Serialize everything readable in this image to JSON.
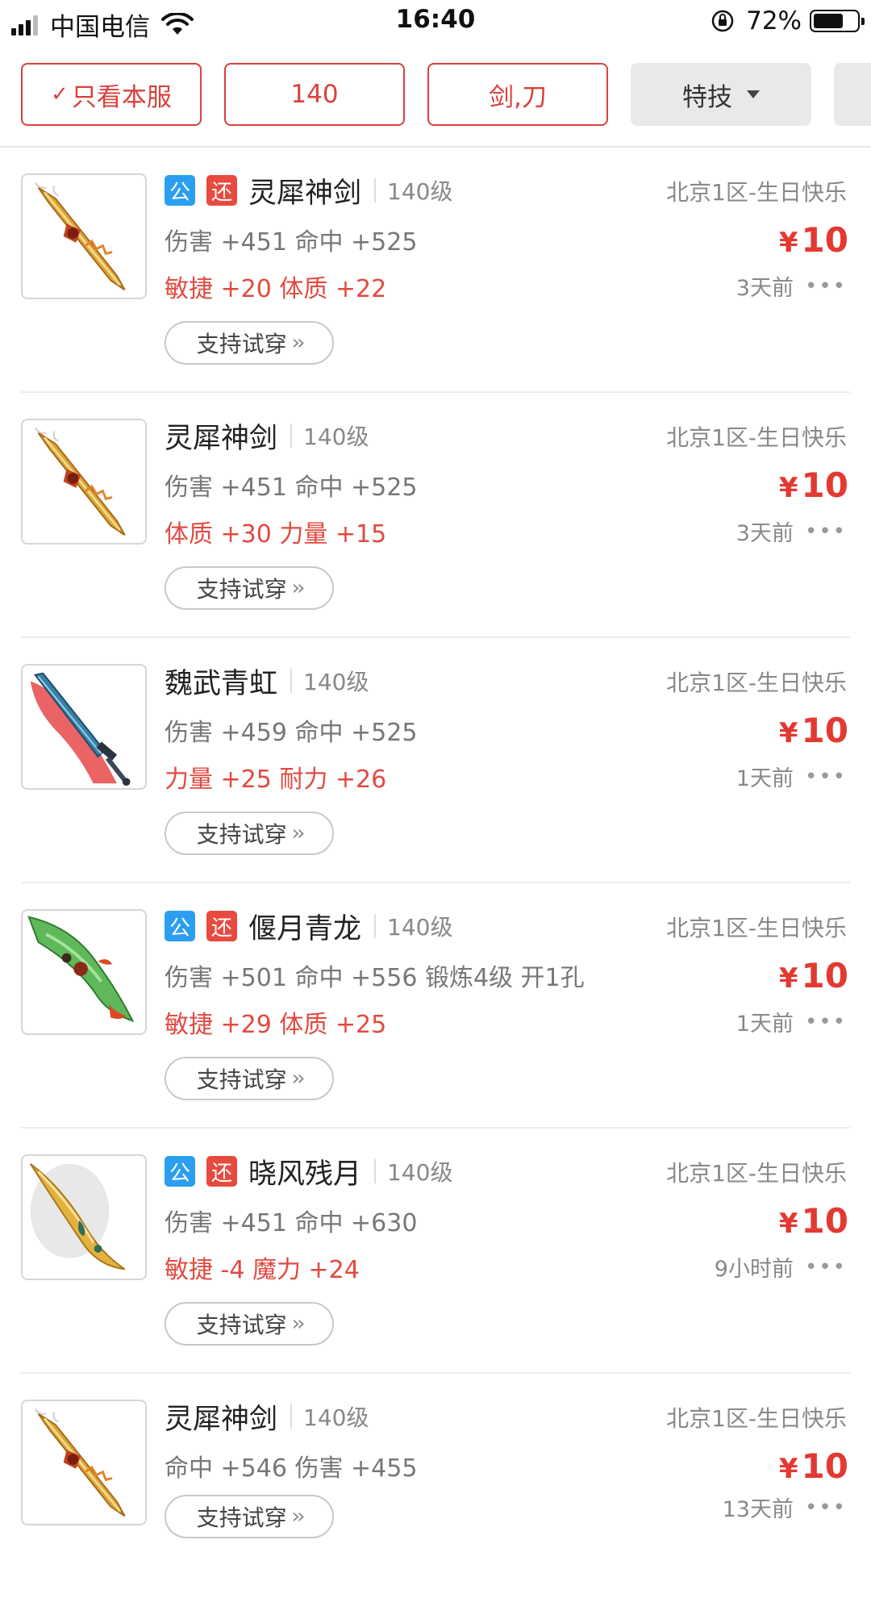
{
  "status_bar": {
    "carrier": "中国电信",
    "time": "16:40",
    "battery_percent": "72%",
    "battery_level": 0.72
  },
  "filters": [
    {
      "label": "只看本服",
      "checked": true,
      "style": "outlined"
    },
    {
      "label": "140",
      "style": "outlined"
    },
    {
      "label": "剑,刀",
      "style": "outlined"
    },
    {
      "label": "特技",
      "style": "dropdown"
    }
  ],
  "listings": [
    {
      "badges": [
        "公",
        "还"
      ],
      "name": "灵犀神剑",
      "level": "140级",
      "stats_primary": "伤害 +451 命中 +525",
      "stats_secondary": "敏捷 +20 体质 +22",
      "try_on": "支持试穿",
      "server": "北京1区-生日快乐",
      "currency": "¥",
      "price": "10",
      "time": "3天前",
      "icon": "golden-sword-icon"
    },
    {
      "badges": [],
      "name": "灵犀神剑",
      "level": "140级",
      "stats_primary": "伤害 +451 命中 +525",
      "stats_secondary": "体质 +30 力量 +15",
      "try_on": "支持试穿",
      "server": "北京1区-生日快乐",
      "currency": "¥",
      "price": "10",
      "time": "3天前",
      "icon": "golden-sword-icon"
    },
    {
      "badges": [],
      "name": "魏武青虹",
      "level": "140级",
      "stats_primary": "伤害 +459 命中 +525",
      "stats_secondary": "力量 +25 耐力 +26",
      "try_on": "支持试穿",
      "server": "北京1区-生日快乐",
      "currency": "¥",
      "price": "10",
      "time": "1天前",
      "icon": "red-blue-sword-icon"
    },
    {
      "badges": [
        "公",
        "还"
      ],
      "name": "偃月青龙",
      "level": "140级",
      "stats_primary": "伤害 +501 命中 +556 锻炼4级 开1孔",
      "stats_secondary": "敏捷 +29 体质 +25",
      "try_on": "支持试穿",
      "server": "北京1区-生日快乐",
      "currency": "¥",
      "price": "10",
      "time": "1天前",
      "icon": "green-dragon-blade-icon"
    },
    {
      "badges": [
        "公",
        "还"
      ],
      "name": "晓风残月",
      "level": "140级",
      "stats_primary": "伤害 +451 命中 +630",
      "stats_secondary": "敏捷 -4 魔力 +24",
      "try_on": "支持试穿",
      "server": "北京1区-生日快乐",
      "currency": "¥",
      "price": "10",
      "time": "9小时前",
      "icon": "golden-curved-blade-icon"
    },
    {
      "badges": [],
      "name": "灵犀神剑",
      "level": "140级",
      "stats_primary": "命中 +546 伤害 +455",
      "stats_secondary": "",
      "try_on": "支持试穿",
      "server": "北京1区-生日快乐",
      "currency": "¥",
      "price": "10",
      "time": "13天前",
      "icon": "golden-sword-icon"
    }
  ],
  "colors": {
    "accent": "#d9413c",
    "price": "#e23a33",
    "badge_gong": "#2b9ef0",
    "badge_huan": "#e84a3f"
  }
}
